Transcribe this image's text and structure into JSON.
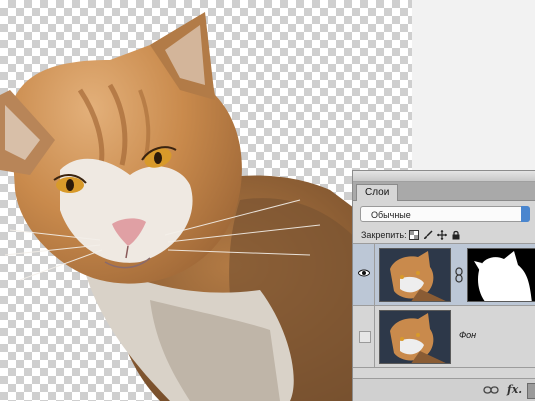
{
  "canvas": {
    "image": "cat-photo-cutout"
  },
  "layers_panel": {
    "tab_label": "Слои",
    "blend_mode": "Обычные",
    "lock_label": "Закрепить:",
    "lock_icons": [
      "lock-transparent-icon",
      "lock-brush-icon",
      "lock-move-icon",
      "lock-all-icon"
    ],
    "layers": [
      {
        "name": "",
        "visible": true,
        "selected": true,
        "has_mask": true
      },
      {
        "name": "Фон",
        "visible": false,
        "selected": false,
        "has_mask": false
      }
    ],
    "bottom_icons": [
      "link-layers-icon",
      "fx-icon",
      "more-icon"
    ],
    "fx_label": "fx."
  }
}
